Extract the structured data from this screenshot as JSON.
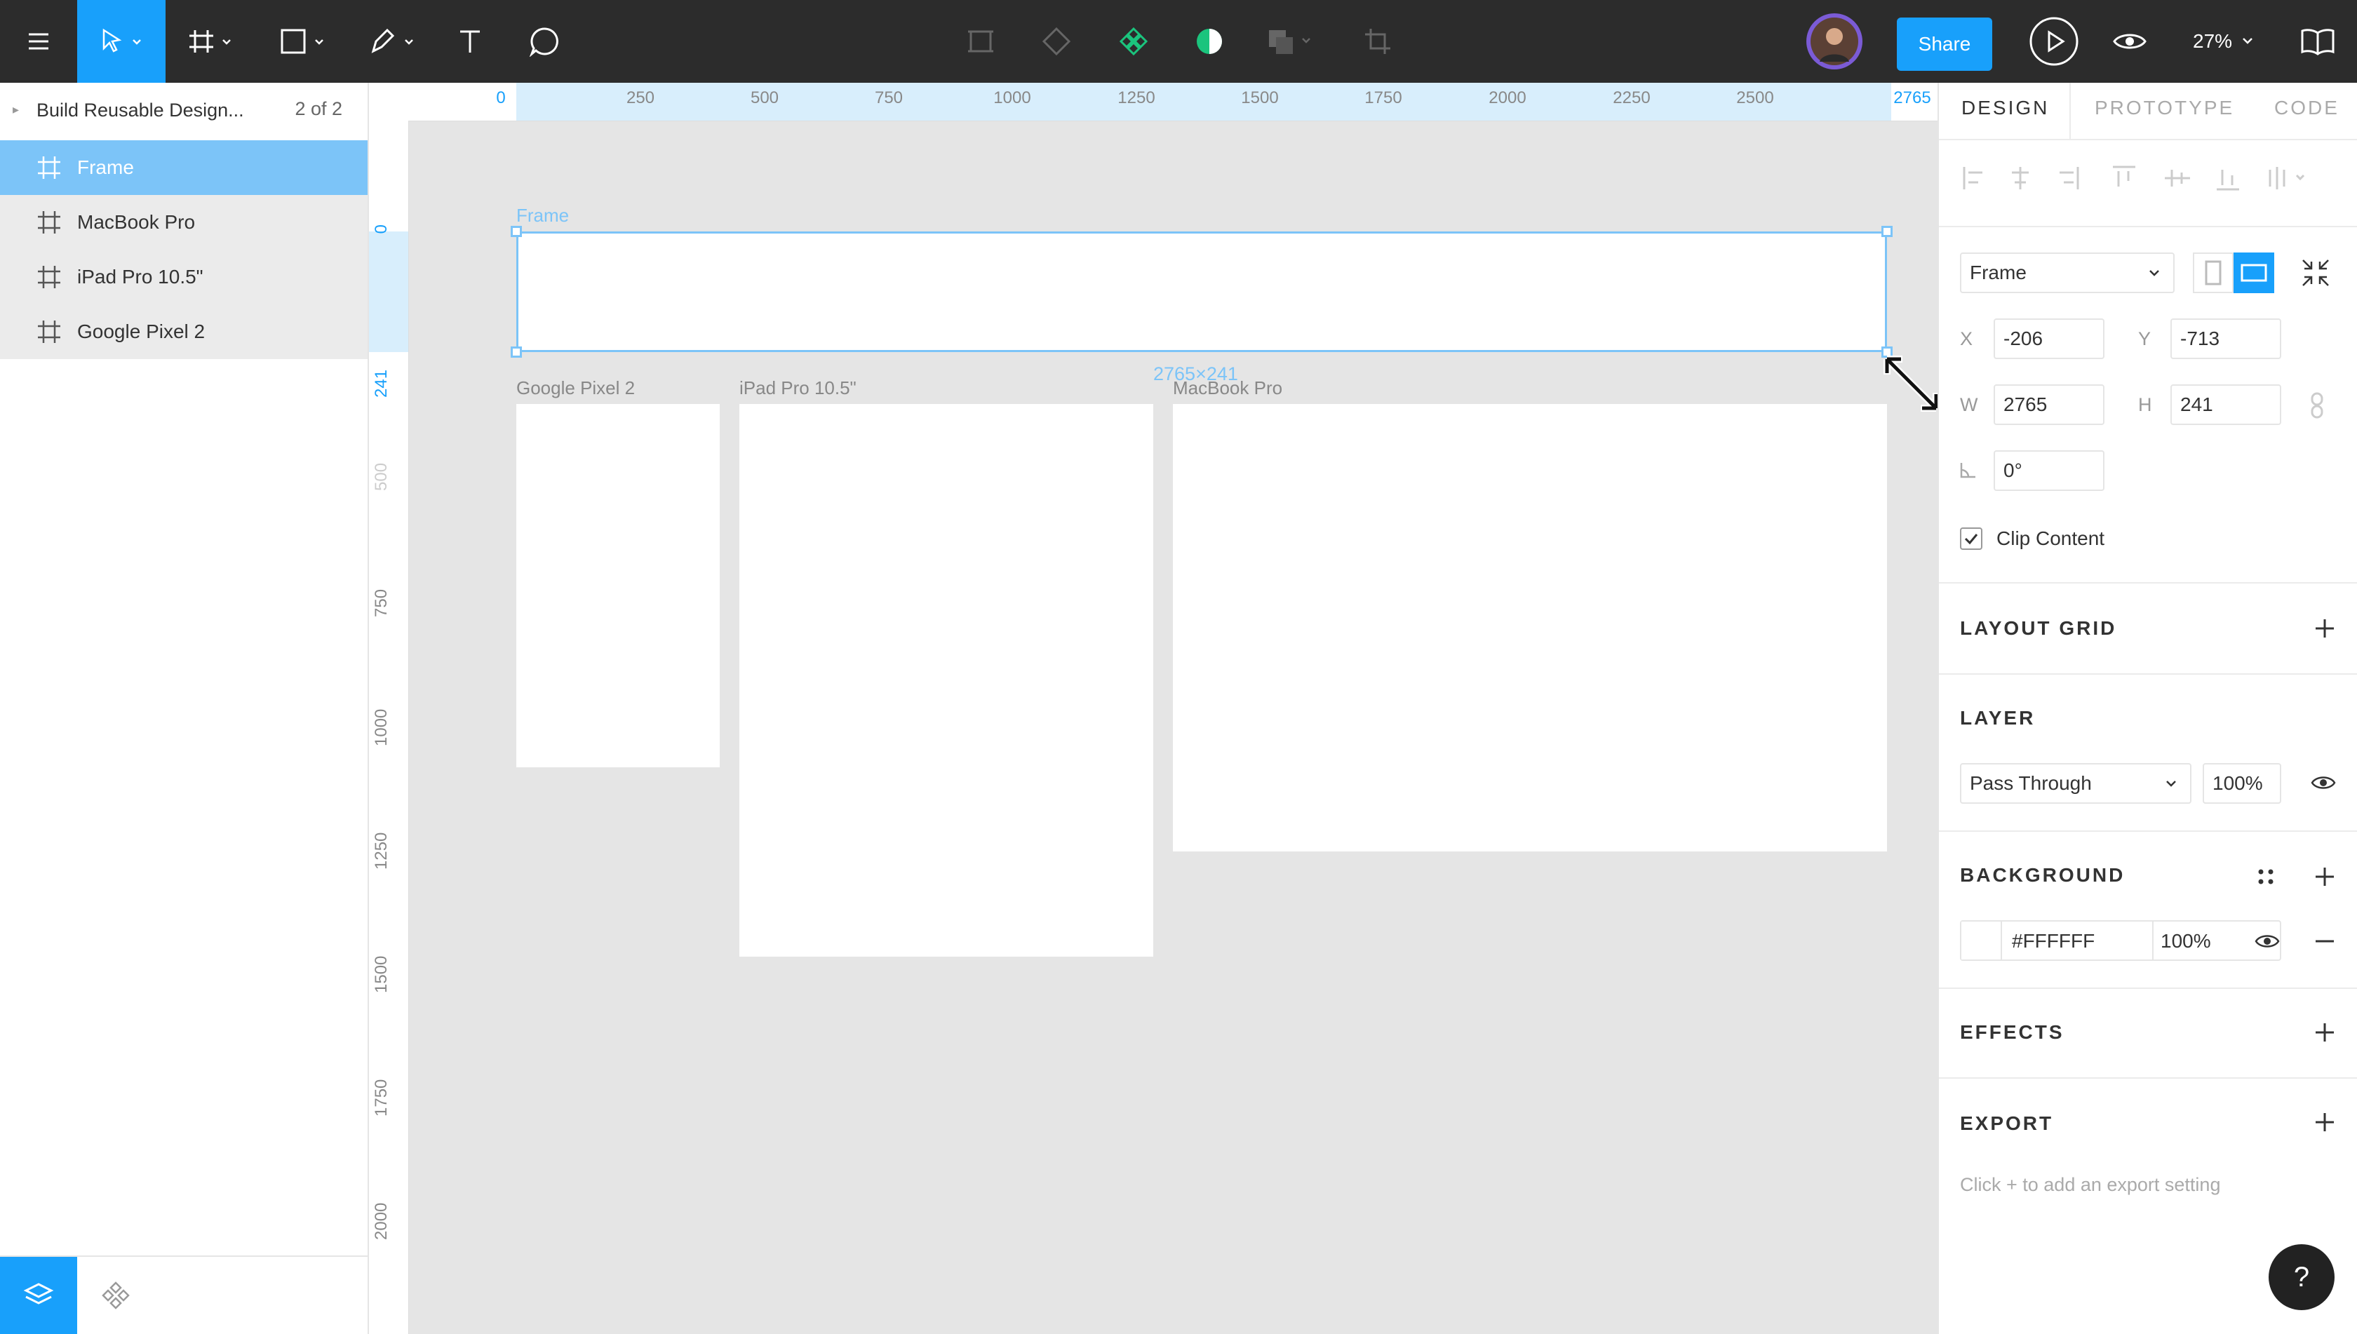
{
  "toolbar": {
    "share_label": "Share",
    "zoom_value": "27%",
    "tools": [
      "menu-icon",
      "move-tool",
      "frame-tool",
      "rectangle-tool",
      "pen-tool",
      "text-tool",
      "comment-tool"
    ],
    "center_tools": [
      "create-component",
      "reset-instance",
      "components",
      "mask",
      "boolean",
      "crop"
    ],
    "accent_color": "#18a0fb"
  },
  "left_panel": {
    "page_name": "Build Reusable Design...",
    "page_count": "2 of 2",
    "layers": [
      {
        "label": "Frame",
        "selected": true
      },
      {
        "label": "MacBook Pro",
        "selected": false
      },
      {
        "label": "iPad Pro 10.5\"",
        "selected": false
      },
      {
        "label": "Google Pixel 2",
        "selected": false
      }
    ]
  },
  "ruler": {
    "top": [
      "0",
      "250",
      "500",
      "750",
      "1000",
      "1250",
      "1500",
      "1750",
      "2000",
      "2250",
      "2500",
      "2765"
    ],
    "left": [
      "0",
      "241",
      "500",
      "750",
      "1000",
      "1250",
      "1500",
      "1750",
      "2000"
    ]
  },
  "canvas": {
    "frame_label": "Frame",
    "artboards": [
      {
        "label": "Google Pixel 2"
      },
      {
        "label": "iPad Pro 10.5\""
      },
      {
        "label": "MacBook Pro"
      }
    ],
    "selection_dimensions": "2765×241"
  },
  "right_panel": {
    "tabs": [
      "DESIGN",
      "PROTOTYPE",
      "CODE"
    ],
    "frame_preset": "Frame",
    "x_label": "X",
    "x_value": "-206",
    "y_label": "Y",
    "y_value": "-713",
    "w_label": "W",
    "w_value": "2765",
    "h_label": "H",
    "h_value": "241",
    "rotation_value": "0°",
    "clip_content_label": "Clip Content",
    "clip_content_checked": true,
    "layout_grid_title": "LAYOUT GRID",
    "layer_title": "LAYER",
    "blend_mode": "Pass Through",
    "layer_opacity": "100%",
    "background_title": "BACKGROUND",
    "background_hex": "#FFFFFF",
    "background_opacity": "100%",
    "effects_title": "EFFECTS",
    "export_title": "EXPORT",
    "export_hint": "Click + to add an export setting",
    "help_label": "?"
  }
}
